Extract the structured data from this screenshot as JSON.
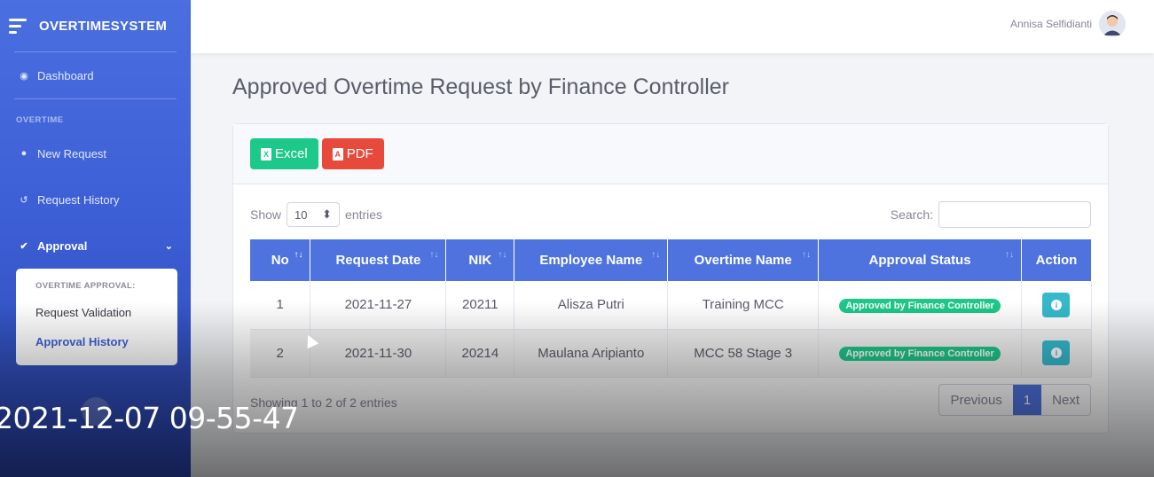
{
  "app": {
    "title": "OVERTIMESYSTEM"
  },
  "sidebar": {
    "dashboard": "Dashboard",
    "section_overtime": "OVERTIME",
    "new_request": "New Request",
    "request_history": "Request History",
    "approval": "Approval",
    "submenu": {
      "heading": "OVERTIME APPROVAL:",
      "items": [
        "Request Validation",
        "Approval History"
      ]
    }
  },
  "topbar": {
    "user_name": "Annisa Selfidianti"
  },
  "page": {
    "title": "Approved Overtime Request by Finance Controller"
  },
  "toolbar": {
    "excel_label": "Excel",
    "pdf_label": "PDF"
  },
  "table_controls": {
    "show_label": "Show",
    "entries_value": "10",
    "entries_label": "entries",
    "search_label": "Search:"
  },
  "table": {
    "columns": [
      "No",
      "Request Date",
      "NIK",
      "Employee Name",
      "Overtime Name",
      "Approval Status",
      "Action"
    ],
    "rows": [
      {
        "no": "1",
        "date": "2021-11-27",
        "nik": "20211",
        "name": "Alisza Putri",
        "overtime": "Training MCC",
        "status": "Approved by Finance Controller"
      },
      {
        "no": "2",
        "date": "2021-11-30",
        "nik": "20214",
        "name": "Maulana Aripianto",
        "overtime": "MCC 58 Stage 3",
        "status": "Approved by Finance Controller"
      }
    ],
    "info": "Showing 1 to 2 of 2 entries"
  },
  "pagination": {
    "previous": "Previous",
    "current": "1",
    "next": "Next"
  },
  "overlay": {
    "timestamp": "2021-12-07 09-55-47"
  },
  "colors": {
    "primary": "#4e73df",
    "success": "#1cc88a",
    "danger": "#e74a3b",
    "info": "#36b9cc"
  }
}
